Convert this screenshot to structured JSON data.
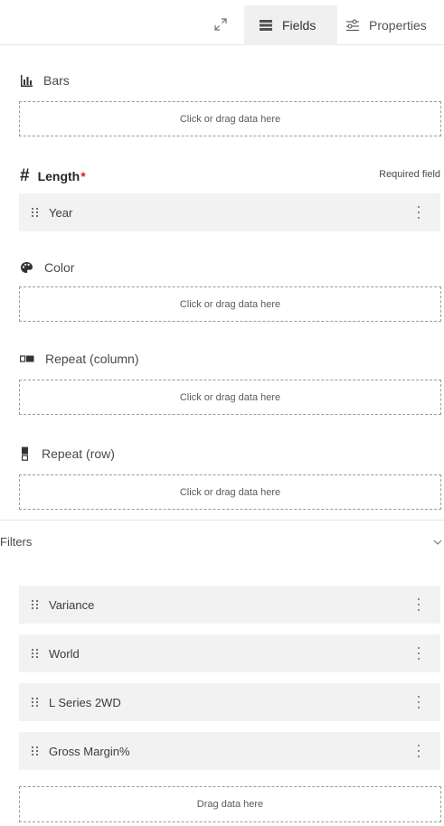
{
  "header": {
    "expand_icon": "maximize-icon",
    "tabs": [
      {
        "label": "Fields",
        "icon": "fields-icon",
        "active": true
      },
      {
        "label": "Properties",
        "icon": "sliders-icon",
        "active": false
      }
    ]
  },
  "slots": {
    "bars": {
      "label": "Bars",
      "icon": "bar-chart-icon",
      "placeholder": "Click or drag data here"
    },
    "length": {
      "hash": "#",
      "label": "Length",
      "required_mark": "*",
      "required_note": "Required field",
      "item": "Year"
    },
    "color": {
      "label": "Color",
      "icon": "palette-icon",
      "placeholder": "Click or drag data here"
    },
    "repeat_column": {
      "label": "Repeat (column)",
      "icon": "repeat-column-icon",
      "placeholder": "Click or drag data here"
    },
    "repeat_row": {
      "label": "Repeat (row)",
      "icon": "repeat-row-icon",
      "placeholder": "Click or drag data here"
    }
  },
  "filters": {
    "label": "Filters",
    "items": [
      "Variance",
      "World",
      "L Series 2WD",
      "Gross Margin%"
    ],
    "placeholder": "Drag data here"
  },
  "colors": {
    "active_tab_bg": "#f0f0f0",
    "pill_bg": "#f2f2f2",
    "required": "#da1e28"
  }
}
